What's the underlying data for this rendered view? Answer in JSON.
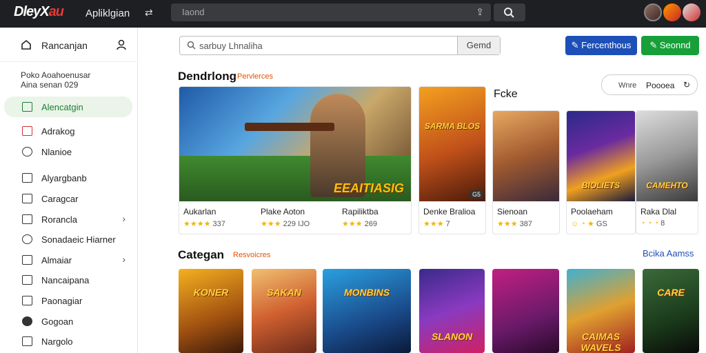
{
  "topbar": {
    "logo_main": "DleyX",
    "logo_accent": "au",
    "app_title": "Apliklgian",
    "search_placeholder": "Iaond",
    "switch_icon": "swap-icon",
    "upload_icon": "upload-icon",
    "search_icon": "search-icon"
  },
  "sidebar": {
    "header_title": "Rancanjan",
    "subtitle_line1": "Poko Aoahoenusar",
    "subtitle_line2": "Aina senan 029",
    "items": [
      {
        "label": "Alencatgin",
        "icon": "gamepad-icon",
        "active": true
      },
      {
        "label": "Adrakog",
        "icon": "mail-icon"
      },
      {
        "label": "Nlanioe",
        "icon": "clock-icon"
      },
      {
        "label": "Alyargbanb",
        "icon": "inbox-icon"
      },
      {
        "label": "Caragcar",
        "icon": "box-icon"
      },
      {
        "label": "Rorancla",
        "icon": "bag-icon",
        "chevron": true
      },
      {
        "label": "Sonadaeic Hiarner",
        "icon": "gear-icon"
      },
      {
        "label": "Almaiar",
        "icon": "monitor-icon",
        "chevron": true
      },
      {
        "label": "Nancaipana",
        "icon": "card-icon"
      },
      {
        "label": "Paonagiar",
        "icon": "building-icon"
      },
      {
        "label": "Gogoan",
        "icon": "globe-icon"
      },
      {
        "label": "Nargolo",
        "icon": "square-icon"
      }
    ]
  },
  "toolbar": {
    "search_placeholder": "sarbuy Lhnaliha",
    "search_button": "Gemd",
    "primary_button": "Fercenthous",
    "secondary_button": "Seonnd"
  },
  "featured": {
    "title": "Dendrlong",
    "subtitle": "Pervlerces",
    "side_label": "Fcke",
    "filter_left": "Wnre",
    "filter_right": "Poooea",
    "banner_caption": "EEAITIASIG",
    "banner_games": [
      {
        "name": "Aukarlan",
        "stars": "★★★★",
        "rating": "337"
      },
      {
        "name": "Plake Aoton",
        "stars": "★★★",
        "rating": "229 IJO"
      },
      {
        "name": "Rapiliktba",
        "stars": "★★★",
        "rating": "269"
      }
    ],
    "cards": [
      {
        "name": "Denke Bralioa",
        "stars": "★★★",
        "rating": "7",
        "caption": "SARMA BLOS",
        "badge": "G5"
      },
      {
        "name": "Sienoan",
        "stars": "★★★",
        "rating": "387"
      },
      {
        "name": "Poolaeham",
        "stars": "☺ ◔ ★",
        "rating": "GS",
        "caption": "BIOLIETS"
      },
      {
        "name": "Raka Dlal",
        "stars": "◔ ◔ ◔",
        "rating": "8",
        "caption": "CAMEHTO"
      }
    ]
  },
  "categories": {
    "title": "Categan",
    "subtitle": "Resvoicres",
    "see_all": "Bcika Aamss",
    "tiles": [
      {
        "caption": "KONER"
      },
      {
        "caption": "SAKAN"
      },
      {
        "caption": "MONBINS"
      },
      {
        "caption": "SLANON"
      },
      {
        "caption": ""
      },
      {
        "caption": "CAIMAS WAVELS"
      },
      {
        "caption": "CARE"
      }
    ]
  }
}
